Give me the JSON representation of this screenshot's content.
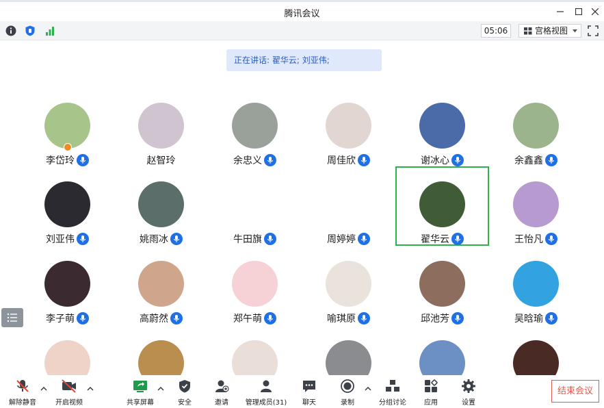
{
  "window": {
    "title": "腾讯会议"
  },
  "toolbar": {
    "timer": "05:06",
    "view_label": "宫格视图"
  },
  "speaking": {
    "text": "正在讲话: 翟华云; 刘亚伟;"
  },
  "participants": [
    {
      "name": "李岱玲",
      "mic": true,
      "host": true,
      "avatar_color": "#a7c58a"
    },
    {
      "name": "赵智玲",
      "mic": false,
      "avatar_color": "#cfc4cf"
    },
    {
      "name": "余忠义",
      "mic": true,
      "avatar_color": "#9aa19a"
    },
    {
      "name": "周佳欣",
      "mic": true,
      "avatar_color": "#e2d6d2"
    },
    {
      "name": "谢冰心",
      "mic": true,
      "avatar_color": "#4b6aa8"
    },
    {
      "name": "余鑫鑫",
      "mic": true,
      "avatar_color": "#9cb48e"
    },
    {
      "name": "刘亚伟",
      "mic": true,
      "avatar_color": "#2a2a30"
    },
    {
      "name": "姚雨冰",
      "mic": true,
      "avatar_color": "#5c6e6a"
    },
    {
      "name": "牛田旗",
      "mic": true,
      "avatar_color": "#ffffff"
    },
    {
      "name": "周婷婷",
      "mic": true,
      "avatar_color": "#ffffff"
    },
    {
      "name": "翟华云",
      "mic": true,
      "speaking": true,
      "avatar_color": "#3f5c36"
    },
    {
      "name": "王怡凡",
      "mic": true,
      "avatar_color": "#b79bd0"
    },
    {
      "name": "李子萌",
      "mic": true,
      "avatar_color": "#3b2a30"
    },
    {
      "name": "高蔚然",
      "mic": true,
      "avatar_color": "#cfa58c"
    },
    {
      "name": "郑午萌",
      "mic": true,
      "avatar_color": "#f6d2d6"
    },
    {
      "name": "喻琪原",
      "mic": true,
      "avatar_color": "#e9e3dc"
    },
    {
      "name": "邱池芳",
      "mic": true,
      "avatar_color": "#8c6d5e"
    },
    {
      "name": "吴晗瑜",
      "mic": true,
      "avatar_color": "#33a2e0"
    },
    {
      "name": "",
      "mic": false,
      "avatar_color": "#f0d3c8"
    },
    {
      "name": "",
      "mic": false,
      "avatar_color": "#b98e4e"
    },
    {
      "name": "",
      "mic": false,
      "avatar_color": "#e9dfd8"
    },
    {
      "name": "",
      "mic": false,
      "avatar_color": "#8a8c8f"
    },
    {
      "name": "",
      "mic": false,
      "avatar_color": "#6c8fc4"
    },
    {
      "name": "",
      "mic": false,
      "avatar_color": "#4a2a24"
    }
  ],
  "bottom": {
    "unmute": "解除静音",
    "video": "开启视频",
    "share": "共享屏幕",
    "security": "安全",
    "invite": "邀请",
    "members": "管理成员(31)",
    "chat": "聊天",
    "record": "录制",
    "breakout": "分组讨论",
    "apps": "应用",
    "settings": "设置",
    "end": "结束会议"
  },
  "colors": {
    "accent": "#1f6fe5",
    "speaking_border": "#2bb24c",
    "end": "#e05a4f"
  }
}
